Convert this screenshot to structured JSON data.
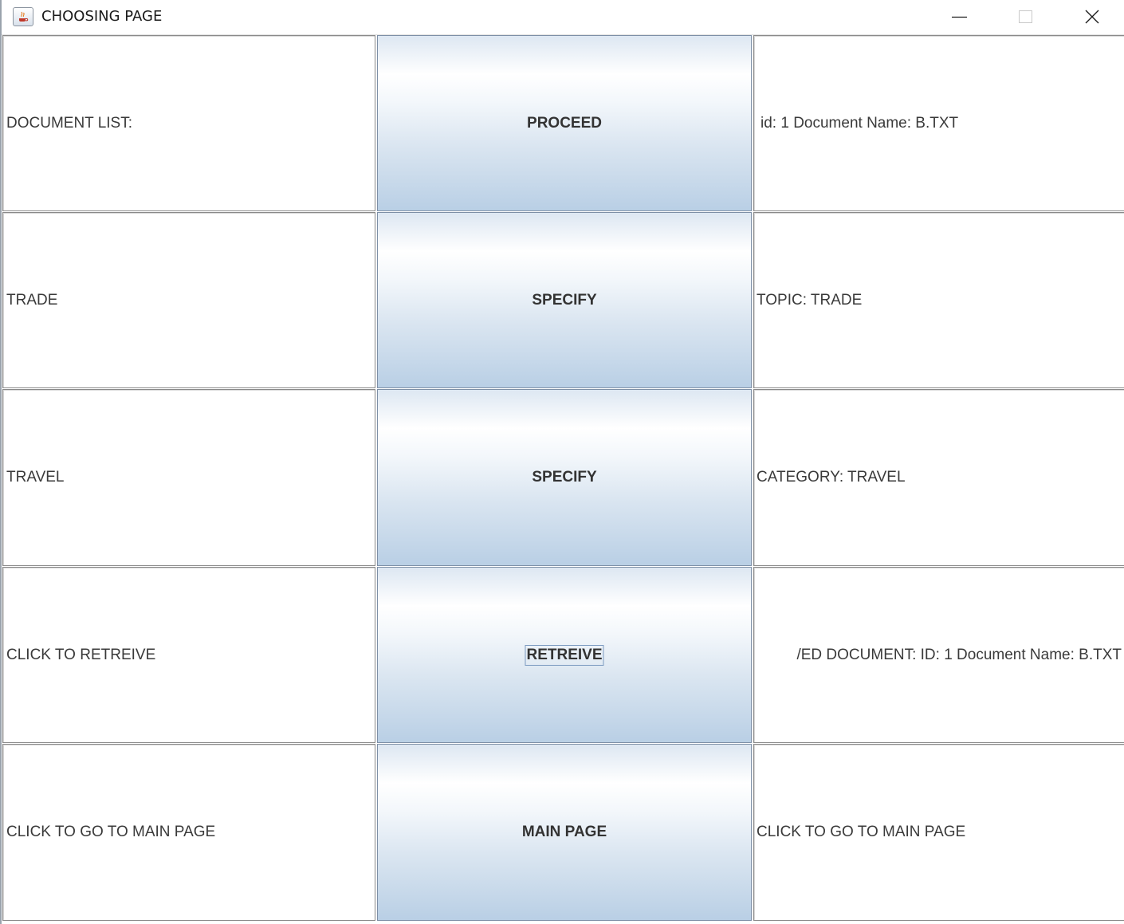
{
  "window": {
    "title": "CHOOSING PAGE",
    "controls": {
      "minimize": "minimize-icon",
      "maximize": "maximize-icon",
      "close": "close-icon"
    }
  },
  "rows": [
    {
      "left_label": "DOCUMENT LIST:",
      "button_label": "PROCEED",
      "right_label": "id: 1 Document Name: B.TXT"
    },
    {
      "left_label": "TRADE",
      "button_label": "SPECIFY",
      "right_label": "TOPIC: TRADE"
    },
    {
      "left_label": "TRAVEL",
      "button_label": "SPECIFY",
      "right_label": "CATEGORY: TRAVEL"
    },
    {
      "left_label": "CLICK TO RETREIVE",
      "button_label": "RETREIVE",
      "right_label": "/ED DOCUMENT: ID: 1  Document Name: B.TXT"
    },
    {
      "left_label": "CLICK TO GO TO MAIN PAGE",
      "button_label": "MAIN PAGE",
      "right_label": "CLICK TO GO TO MAIN PAGE"
    }
  ],
  "colors": {
    "button_top": "#ffffff",
    "button_bottom": "#b9cfe5",
    "cell_border": "#8a8a8a",
    "text": "#3a3a3a"
  }
}
